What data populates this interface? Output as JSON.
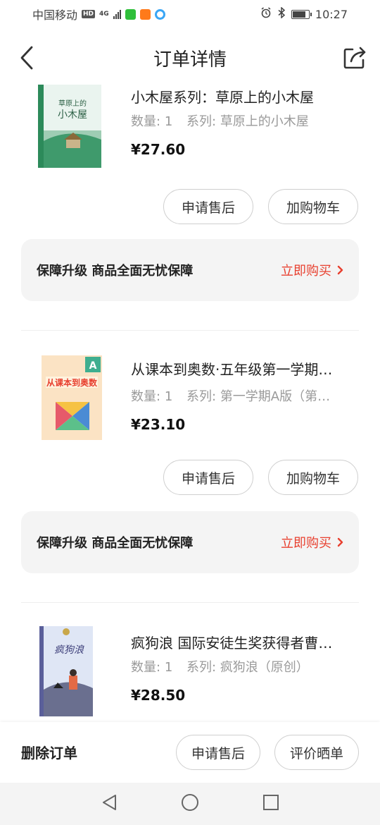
{
  "status_bar": {
    "carrier": "中国移动",
    "hd": "HD",
    "network": "4G",
    "time": "10:27",
    "battery_level": 0.9
  },
  "header": {
    "title": "订单详情"
  },
  "products": [
    {
      "name": "小木屋系列：草原上的小木屋",
      "quantity_label": "数量:",
      "quantity": "1",
      "series_label": "系列:",
      "series": "草原上的小木屋",
      "price": "¥27.60",
      "cover_title": "草原上的小木屋",
      "buttons": [
        "申请售后",
        "加购物车"
      ]
    },
    {
      "name": "从课本到奥数·五年级第一学期…",
      "quantity_label": "数量:",
      "quantity": "1",
      "series_label": "系列:",
      "series": "第一学期A版（第…",
      "price": "¥23.10",
      "cover_title": "从课本到奥数",
      "buttons": [
        "申请售后",
        "加购物车"
      ]
    },
    {
      "name": "疯狗浪 国际安徒生奖获得者曹…",
      "quantity_label": "数量:",
      "quantity": "1",
      "series_label": "系列:",
      "series": "疯狗浪（原创）",
      "price": "¥28.50",
      "cover_title": "疯狗浪"
    }
  ],
  "guarantee": {
    "text": "保障升级  商品全面无忧保障",
    "link": "立即购买"
  },
  "bottom_bar": {
    "delete": "删除订单",
    "after_sale": "申请售后",
    "review": "评价晒单"
  },
  "colors": {
    "accent": "#e8402f",
    "card_bg": "#f4f4f4",
    "muted_text": "#9a9a9a"
  }
}
